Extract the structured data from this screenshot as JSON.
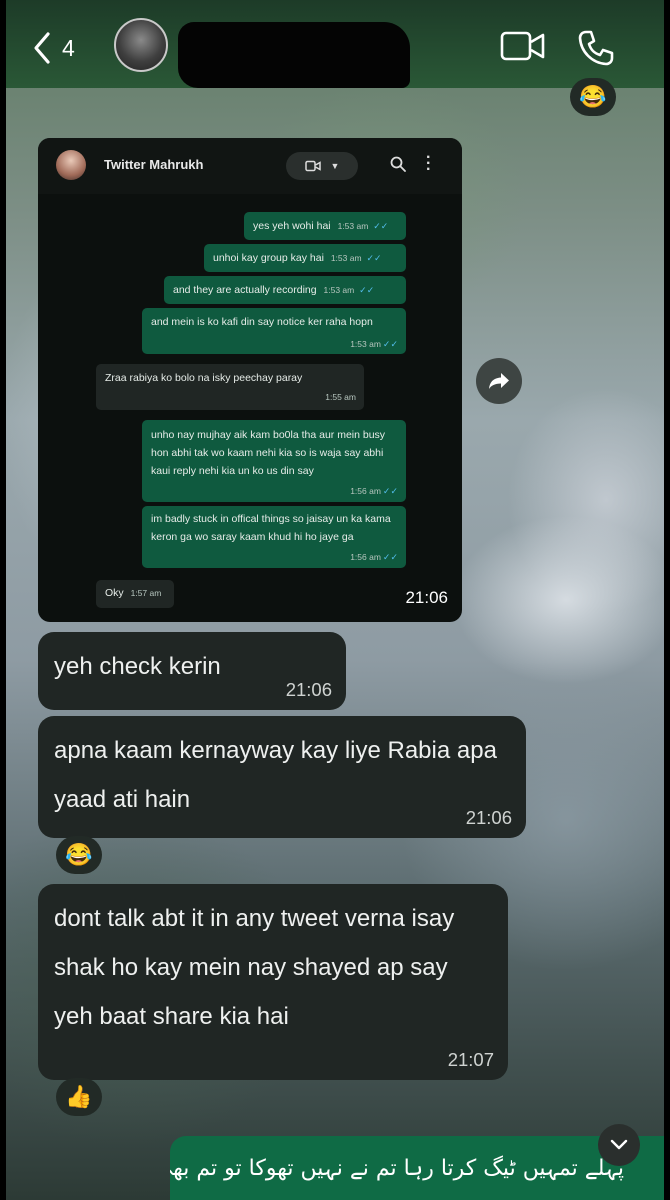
{
  "header": {
    "back_count": "4",
    "icons": {
      "back": "chevron-left-icon",
      "video": "video-camera-icon",
      "call": "phone-icon"
    }
  },
  "top_reaction": {
    "emoji": "😂"
  },
  "embedded_screenshot": {
    "contact_name": "Twitter Mahrukh",
    "time": "21:06",
    "messages": [
      {
        "direction": "out",
        "text": "yes yeh wohi hai",
        "time": "1:53 am"
      },
      {
        "direction": "out",
        "text": "unhoi kay group kay hai",
        "time": "1:53 am"
      },
      {
        "direction": "out",
        "text": "and they are actually recording",
        "time": "1:53 am"
      },
      {
        "direction": "out",
        "text": "and mein is ko kafi din say notice ker raha hopn",
        "time": "1:53 am"
      },
      {
        "direction": "in",
        "text": "Zraa rabiya ko bolo na isky peechay paray",
        "time": "1:55 am"
      },
      {
        "direction": "out",
        "text": "unho nay mujhay aik kam bo0la tha aur mein busy hon abhi tak wo kaam nehi kia so is waja say abhi kaui reply nehi kia un ko us din say",
        "time": "1:56 am"
      },
      {
        "direction": "out",
        "text": "im badly stuck in offical things so jaisay un ka kama keron ga wo saray kaam khud hi ho jaye ga",
        "time": "1:56 am"
      },
      {
        "direction": "in",
        "text": "Oky",
        "time": "1:57 am"
      }
    ],
    "tick": "✓✓"
  },
  "messages": [
    {
      "text": "yeh check kerin",
      "time": "21:06"
    },
    {
      "text": "apna kaam kernayway kay liye Rabia apa yaad ati hain",
      "time": "21:06"
    },
    {
      "text": "dont talk abt it in any tweet verna isay shak ho kay mein nay shayed ap say yeh baat share kia hai",
      "time": "21:07"
    }
  ],
  "reactions": {
    "laugh": "😂",
    "thumbs_up": "👍"
  },
  "outgoing_urdu": {
    "text": "پہلے تمہیں ٹیگ کرتا رہا تم نے نہیں تھوکا تو تم بھی"
  },
  "colors": {
    "header_green": "#2a5836",
    "outgoing_green": "#0f6b45",
    "incoming_dark": "#202624",
    "read_tick": "#53bdeb"
  }
}
